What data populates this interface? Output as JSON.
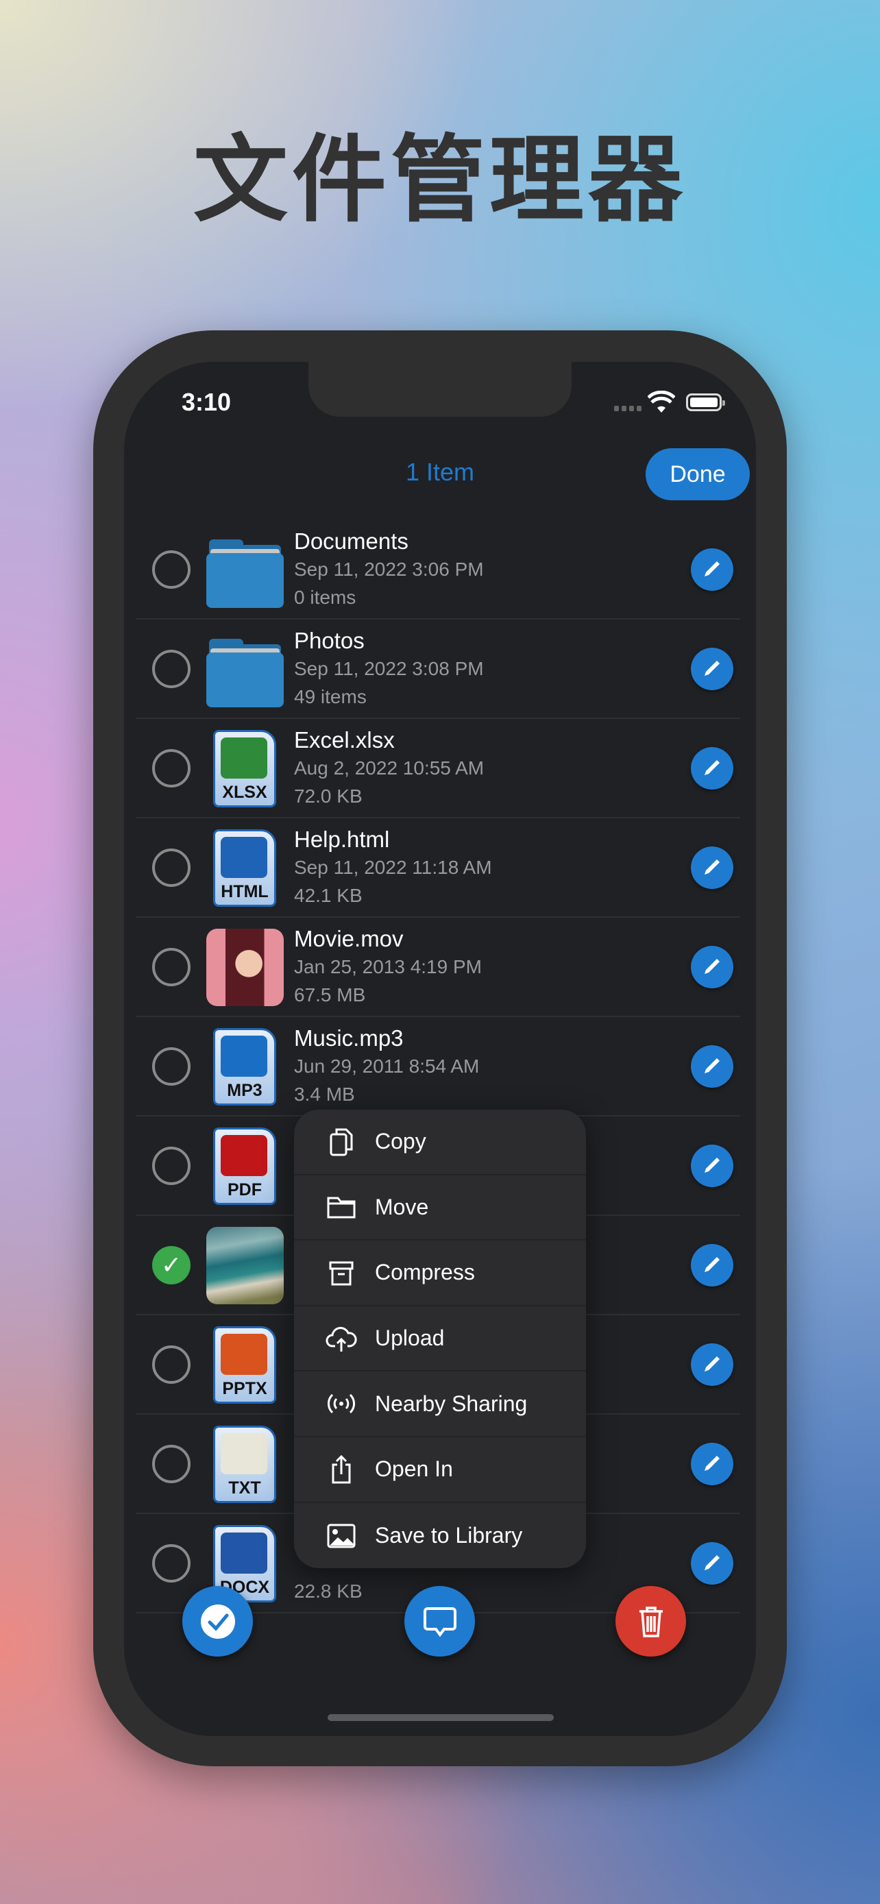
{
  "page_title": "文件管理器",
  "status": {
    "time": "3:10"
  },
  "nav": {
    "title": "1 Item",
    "done_label": "Done"
  },
  "colors": {
    "accent": "#1f7bd0",
    "selected": "#3aa84b",
    "delete": "#d63a2f"
  },
  "rows": [
    {
      "name": "Documents",
      "date": "Sep 11, 2022 3:06 PM",
      "detail": "0 items",
      "icon": "folder",
      "selected": false
    },
    {
      "name": "Photos",
      "date": "Sep 11, 2022 3:08 PM",
      "detail": "49 items",
      "icon": "folder",
      "selected": false
    },
    {
      "name": "Excel.xlsx",
      "date": "Aug 2, 2022 10:55 AM",
      "detail": "72.0 KB",
      "icon": "doc",
      "label": "XLSX",
      "glyph": "#2f8a3a",
      "selected": false
    },
    {
      "name": "Help.html",
      "date": "Sep 11, 2022 11:18 AM",
      "detail": "42.1 KB",
      "icon": "doc",
      "label": "HTML",
      "glyph": "#1e63b5",
      "selected": false
    },
    {
      "name": "Movie.mov",
      "date": "Jan 25, 2013 4:19 PM",
      "detail": "67.5 MB",
      "icon": "movie",
      "selected": false
    },
    {
      "name": "Music.mp3",
      "date": "Jun 29, 2011 8:54 AM",
      "detail": "3.4 MB",
      "icon": "doc",
      "label": "MP3",
      "glyph": "#1a6fc4",
      "selected": false
    },
    {
      "icon": "doc",
      "label": "PDF",
      "glyph": "#c0161a",
      "selected": false
    },
    {
      "icon": "beach",
      "selected": true
    },
    {
      "icon": "doc",
      "label": "PPTX",
      "glyph": "#d9531e",
      "selected": false
    },
    {
      "icon": "doc",
      "label": "TXT",
      "glyph": "#e8e6d8",
      "selected": false
    },
    {
      "detail": "22.8 KB",
      "icon": "doc",
      "label": "DOCX",
      "glyph": "#2156a8",
      "selected": false
    }
  ],
  "menu": [
    {
      "label": "Copy",
      "icon": "copy-icon"
    },
    {
      "label": "Move",
      "icon": "folder-icon"
    },
    {
      "label": "Compress",
      "icon": "archive-icon"
    },
    {
      "label": "Upload",
      "icon": "cloud-upload-icon"
    },
    {
      "label": "Nearby Sharing",
      "icon": "broadcast-icon"
    },
    {
      "label": "Open In",
      "icon": "share-icon"
    },
    {
      "label": "Save to Library",
      "icon": "photo-icon"
    }
  ]
}
